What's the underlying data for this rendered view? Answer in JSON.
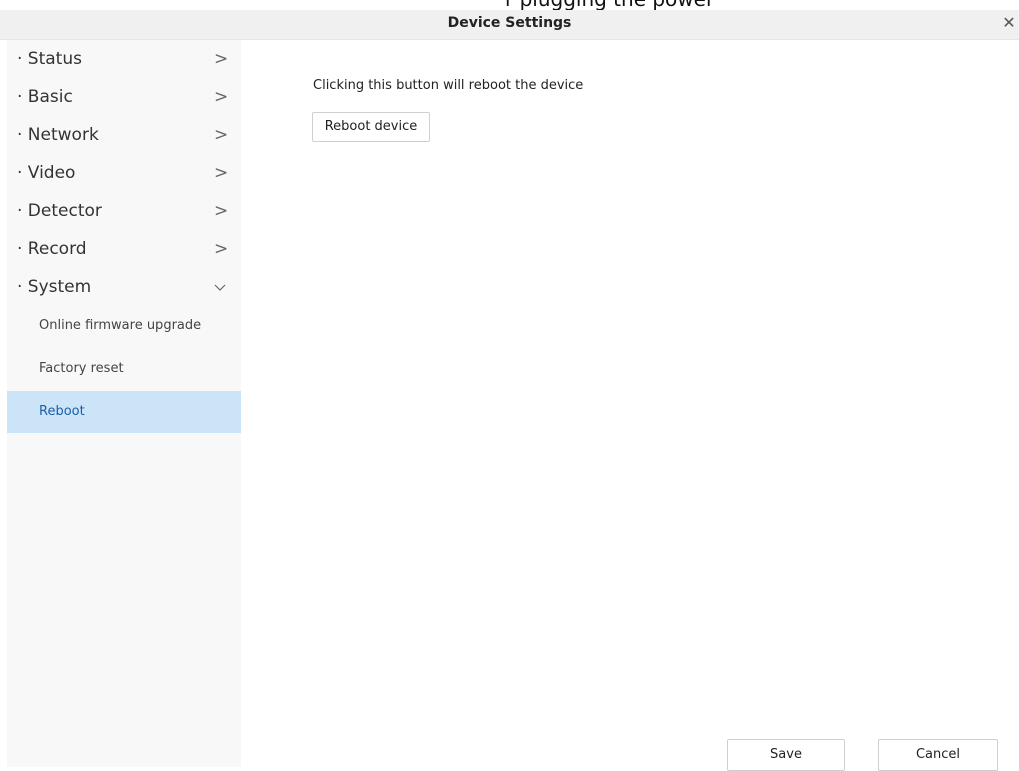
{
  "header": {
    "clipped_top_text": "r plugging the power",
    "title": "Device Settings",
    "close_icon": "close-icon"
  },
  "sidebar": {
    "items": [
      {
        "label": "· Status",
        "chevron": ">"
      },
      {
        "label": "· Basic",
        "chevron": ">"
      },
      {
        "label": "· Network",
        "chevron": ">"
      },
      {
        "label": "· Video",
        "chevron": ">"
      },
      {
        "label": "· Detector",
        "chevron": ">"
      },
      {
        "label": "· Record",
        "chevron": ">"
      },
      {
        "label": "· System",
        "chevron": "v"
      }
    ],
    "sub_items": [
      {
        "label": "Online firmware upgrade",
        "active": false
      },
      {
        "label": "Factory reset",
        "active": false
      },
      {
        "label": "Reboot",
        "active": true
      }
    ]
  },
  "main": {
    "description": "Clicking this button will reboot the device",
    "reboot_label": "Reboot device"
  },
  "footer": {
    "save_label": "Save",
    "cancel_label": "Cancel"
  },
  "colors": {
    "active_bg": "#cce4f7",
    "active_text": "#1a5fa8",
    "sidebar_bg": "#f8f8f8",
    "titlebar_bg": "#f0f0f0"
  }
}
